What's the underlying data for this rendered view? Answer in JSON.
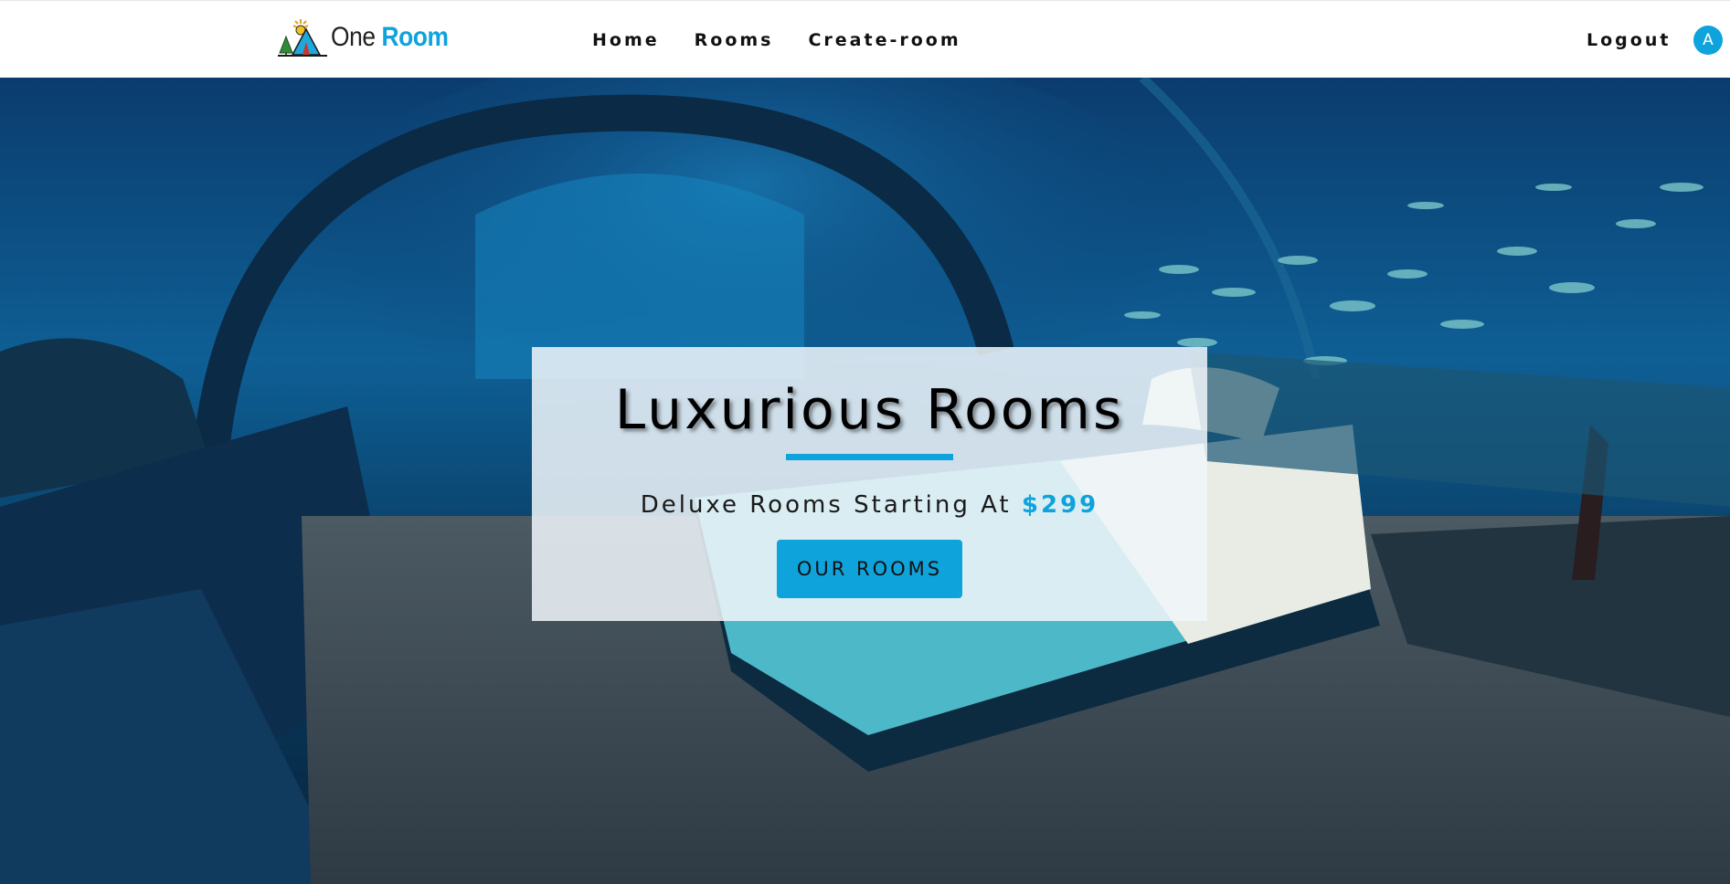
{
  "brand": {
    "name_part1": "One",
    "name_part2": "Room",
    "accent_color": "#0fa3dc"
  },
  "nav": {
    "links": [
      {
        "label": "Home"
      },
      {
        "label": "Rooms"
      },
      {
        "label": "Create-room"
      }
    ],
    "logout_label": "Logout",
    "avatar_initial": "A"
  },
  "hero": {
    "image": "underwater-bedroom",
    "title": "Luxurious Rooms",
    "subtitle_prefix": "Deluxe Rooms Starting At ",
    "price": "$299",
    "button_label": "OUR ROOMS"
  }
}
